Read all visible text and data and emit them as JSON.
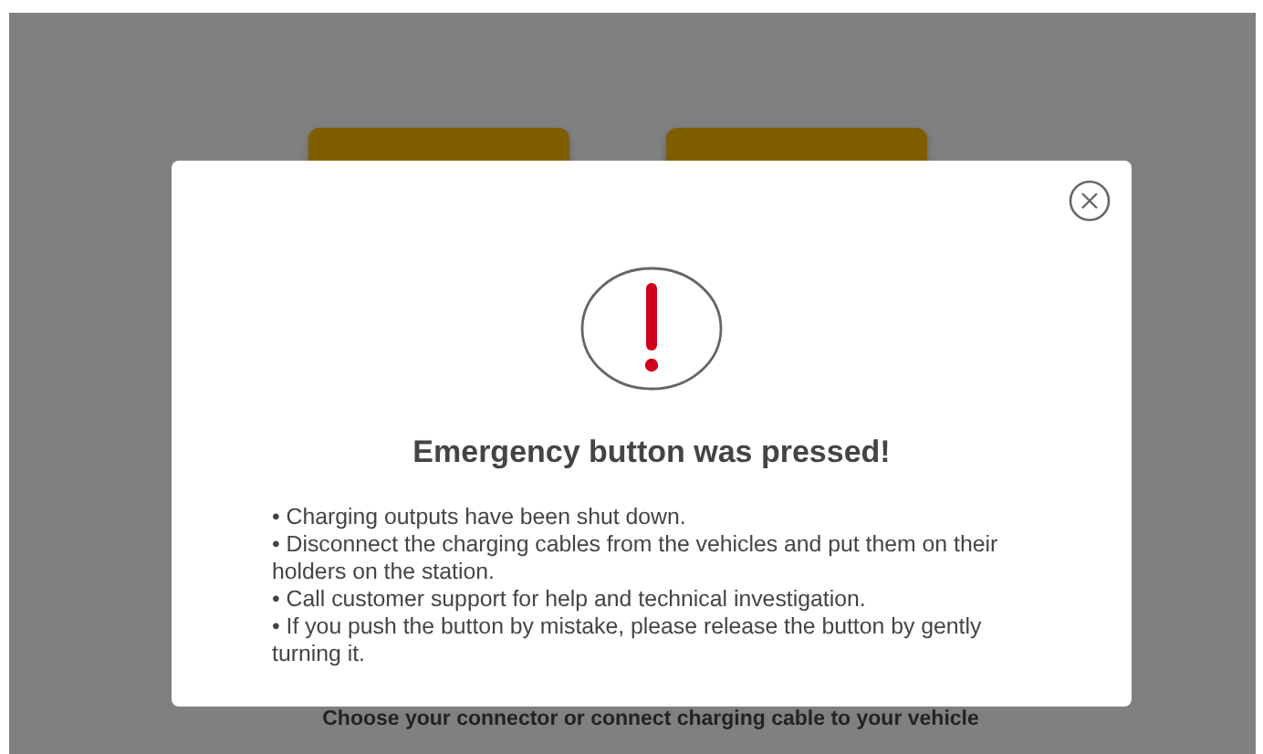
{
  "connectors": [
    {
      "kind": "connector"
    },
    {
      "kind": "connector"
    }
  ],
  "instruction": "Choose your connector or connect charging cable to your vehicle",
  "dialog": {
    "title": "Emergency button was pressed!",
    "bullets": [
      "• Charging outputs have been shut down.",
      "• Disconnect the charging cables from the vehicles and put them on their holders on the station.",
      "• Call customer support for help and technical investigation.",
      "• If you push the button by mistake, please release the button by gently turning it."
    ]
  }
}
